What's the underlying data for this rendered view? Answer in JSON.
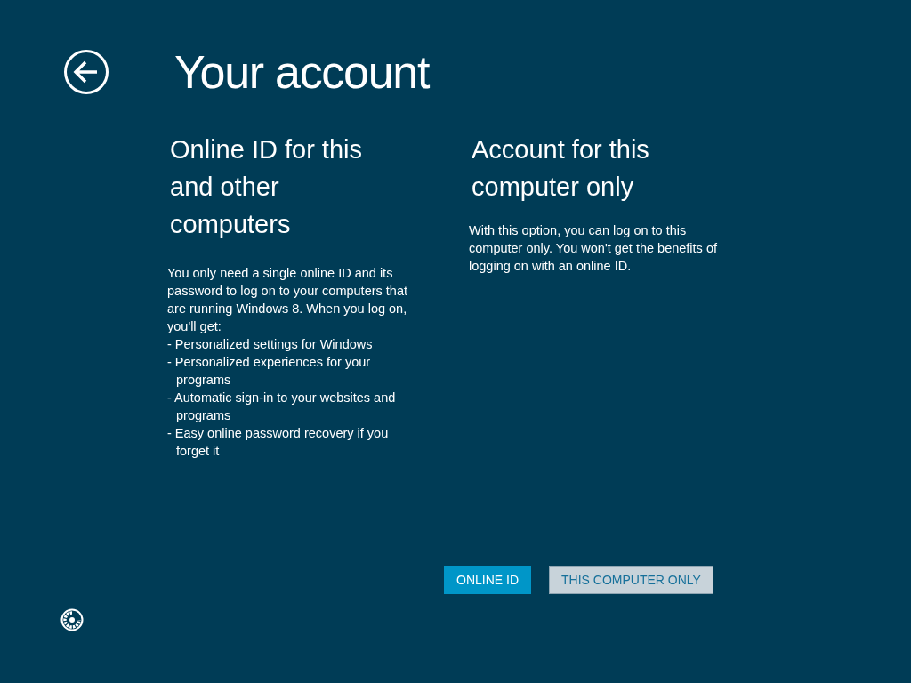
{
  "title": "Your account",
  "options": [
    {
      "heading": "Online ID for this and other computers",
      "description": "You only need a single online ID and its password to log on to your computers that are running Windows 8. When you log on, you'll get:",
      "bullets": [
        "- Personalized settings for Windows",
        "- Personalized experiences for your programs",
        "- Automatic sign-in to your websites and programs",
        "- Easy online password recovery if you forget it"
      ]
    },
    {
      "heading": "Account for this computer only",
      "description": "With this option, you can log on to this computer only. You won't get the benefits of logging on with an online ID."
    }
  ],
  "buttons": [
    {
      "label": "ONLINE ID",
      "kind": "primary"
    },
    {
      "label": "THIS COMPUTER ONLY",
      "kind": "secondary"
    }
  ]
}
